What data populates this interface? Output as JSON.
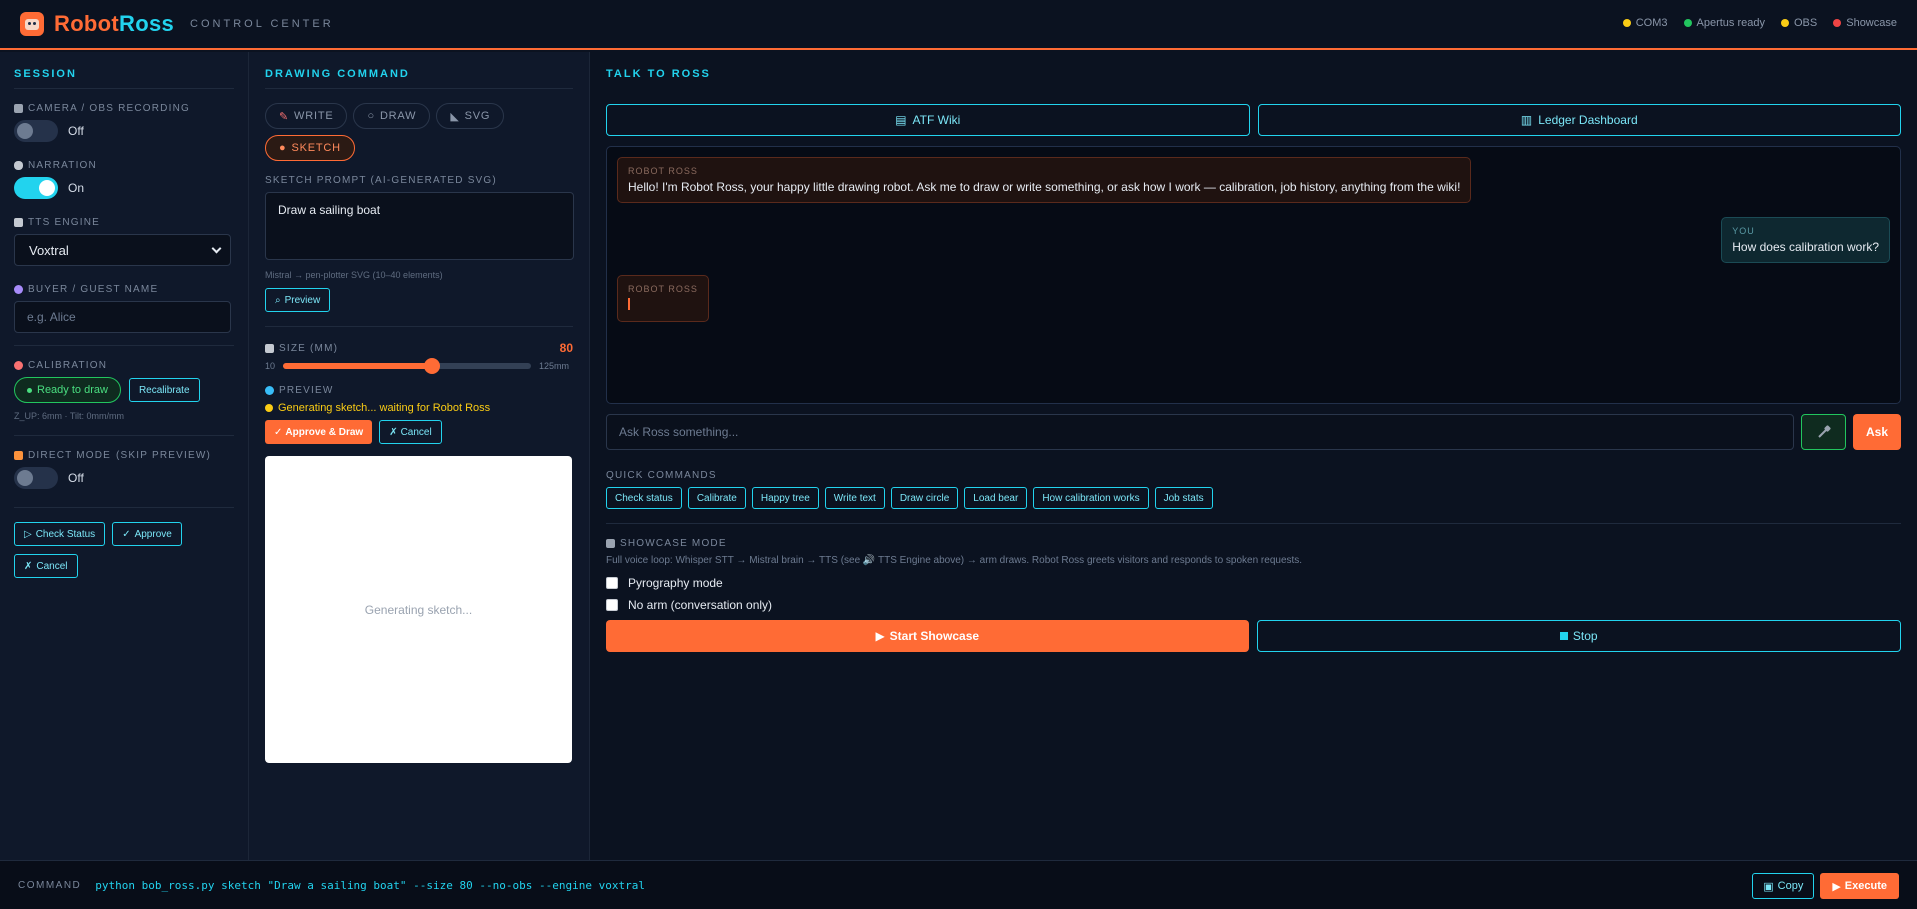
{
  "header": {
    "brand_part1": "Robot",
    "brand_part2": "Ross",
    "subtitle": "CONTROL CENTER",
    "status": [
      {
        "label": "COM3",
        "color": "#facc15"
      },
      {
        "label": "Apertus ready",
        "color": "#22c55e"
      },
      {
        "label": "OBS",
        "color": "#facc15"
      },
      {
        "label": "Showcase",
        "color": "#ef4444"
      }
    ]
  },
  "session": {
    "title": "SESSION",
    "camera_label": "CAMERA / OBS RECORDING",
    "camera_state": "Off",
    "narration_label": "NARRATION",
    "narration_state": "On",
    "tts_label": "TTS ENGINE",
    "tts_value": "Voxtral",
    "buyer_label": "BUYER / GUEST NAME",
    "buyer_placeholder": "e.g. Alice",
    "calibration_label": "CALIBRATION",
    "calibration_status": "Ready to draw",
    "recalibrate_label": "Recalibrate",
    "calibration_meta": "Z_UP: 6mm · Tilt: 0mm/mm",
    "direct_label": "DIRECT MODE",
    "direct_sub": "(SKIP PREVIEW)",
    "direct_state": "Off",
    "check_status_label": "Check Status",
    "approve_label": "Approve",
    "cancel_label": "Cancel"
  },
  "drawing": {
    "title": "DRAWING COMMAND",
    "tabs": {
      "write": "WRITE",
      "draw": "DRAW",
      "svg": "SVG",
      "sketch": "SKETCH"
    },
    "prompt_label": "SKETCH PROMPT (AI-GENERATED SVG)",
    "prompt_value": "Draw a sailing boat",
    "hint": "Mistral → pen-plotter SVG (10–40 elements)",
    "preview_button": "Preview",
    "size_label": "SIZE (MM)",
    "size_value": "80",
    "size_min": "10",
    "size_max": "125mm",
    "size_fraction": 0.6,
    "preview_label": "PREVIEW",
    "gen_status": "Generating sketch... waiting for Robot Ross",
    "approve_draw": "Approve & Draw",
    "cancel": "Cancel",
    "preview_placeholder": "Generating sketch..."
  },
  "talk": {
    "title": "TALK TO ROSS",
    "link1": "ATF Wiki",
    "link2": "Ledger Dashboard",
    "messages": {
      "ross_who": "ROBOT ROSS",
      "ross_text": "Hello! I'm Robot Ross, your happy little drawing robot. Ask me to draw or write something, or ask how I work — calibration, job history, anything from the wiki!",
      "user_who": "YOU",
      "user_text": "How does calibration work?",
      "ross2_who": "ROBOT ROSS"
    },
    "ask_placeholder": "Ask Ross something...",
    "ask_button": "Ask",
    "quick_title": "QUICK COMMANDS",
    "quick": [
      "Check status",
      "Calibrate",
      "Happy tree",
      "Write text",
      "Draw circle",
      "Load bear",
      "How calibration works",
      "Job stats"
    ],
    "showcase_title": "SHOWCASE MODE",
    "showcase_desc": "Full voice loop: Whisper STT → Mistral brain → TTS (see 🔊 TTS Engine above) → arm draws. Robot Ross greets visitors and responds to spoken requests.",
    "pyro_label": "Pyrography mode",
    "noarm_label": "No arm (conversation only)",
    "start_label": "Start Showcase",
    "stop_label": "Stop"
  },
  "footer": {
    "label": "COMMAND",
    "command": "python bob_ross.py sketch \"Draw a sailing boat\" --size 80 --no-obs --engine voxtral",
    "copy_label": "Copy",
    "execute_label": "Execute"
  }
}
